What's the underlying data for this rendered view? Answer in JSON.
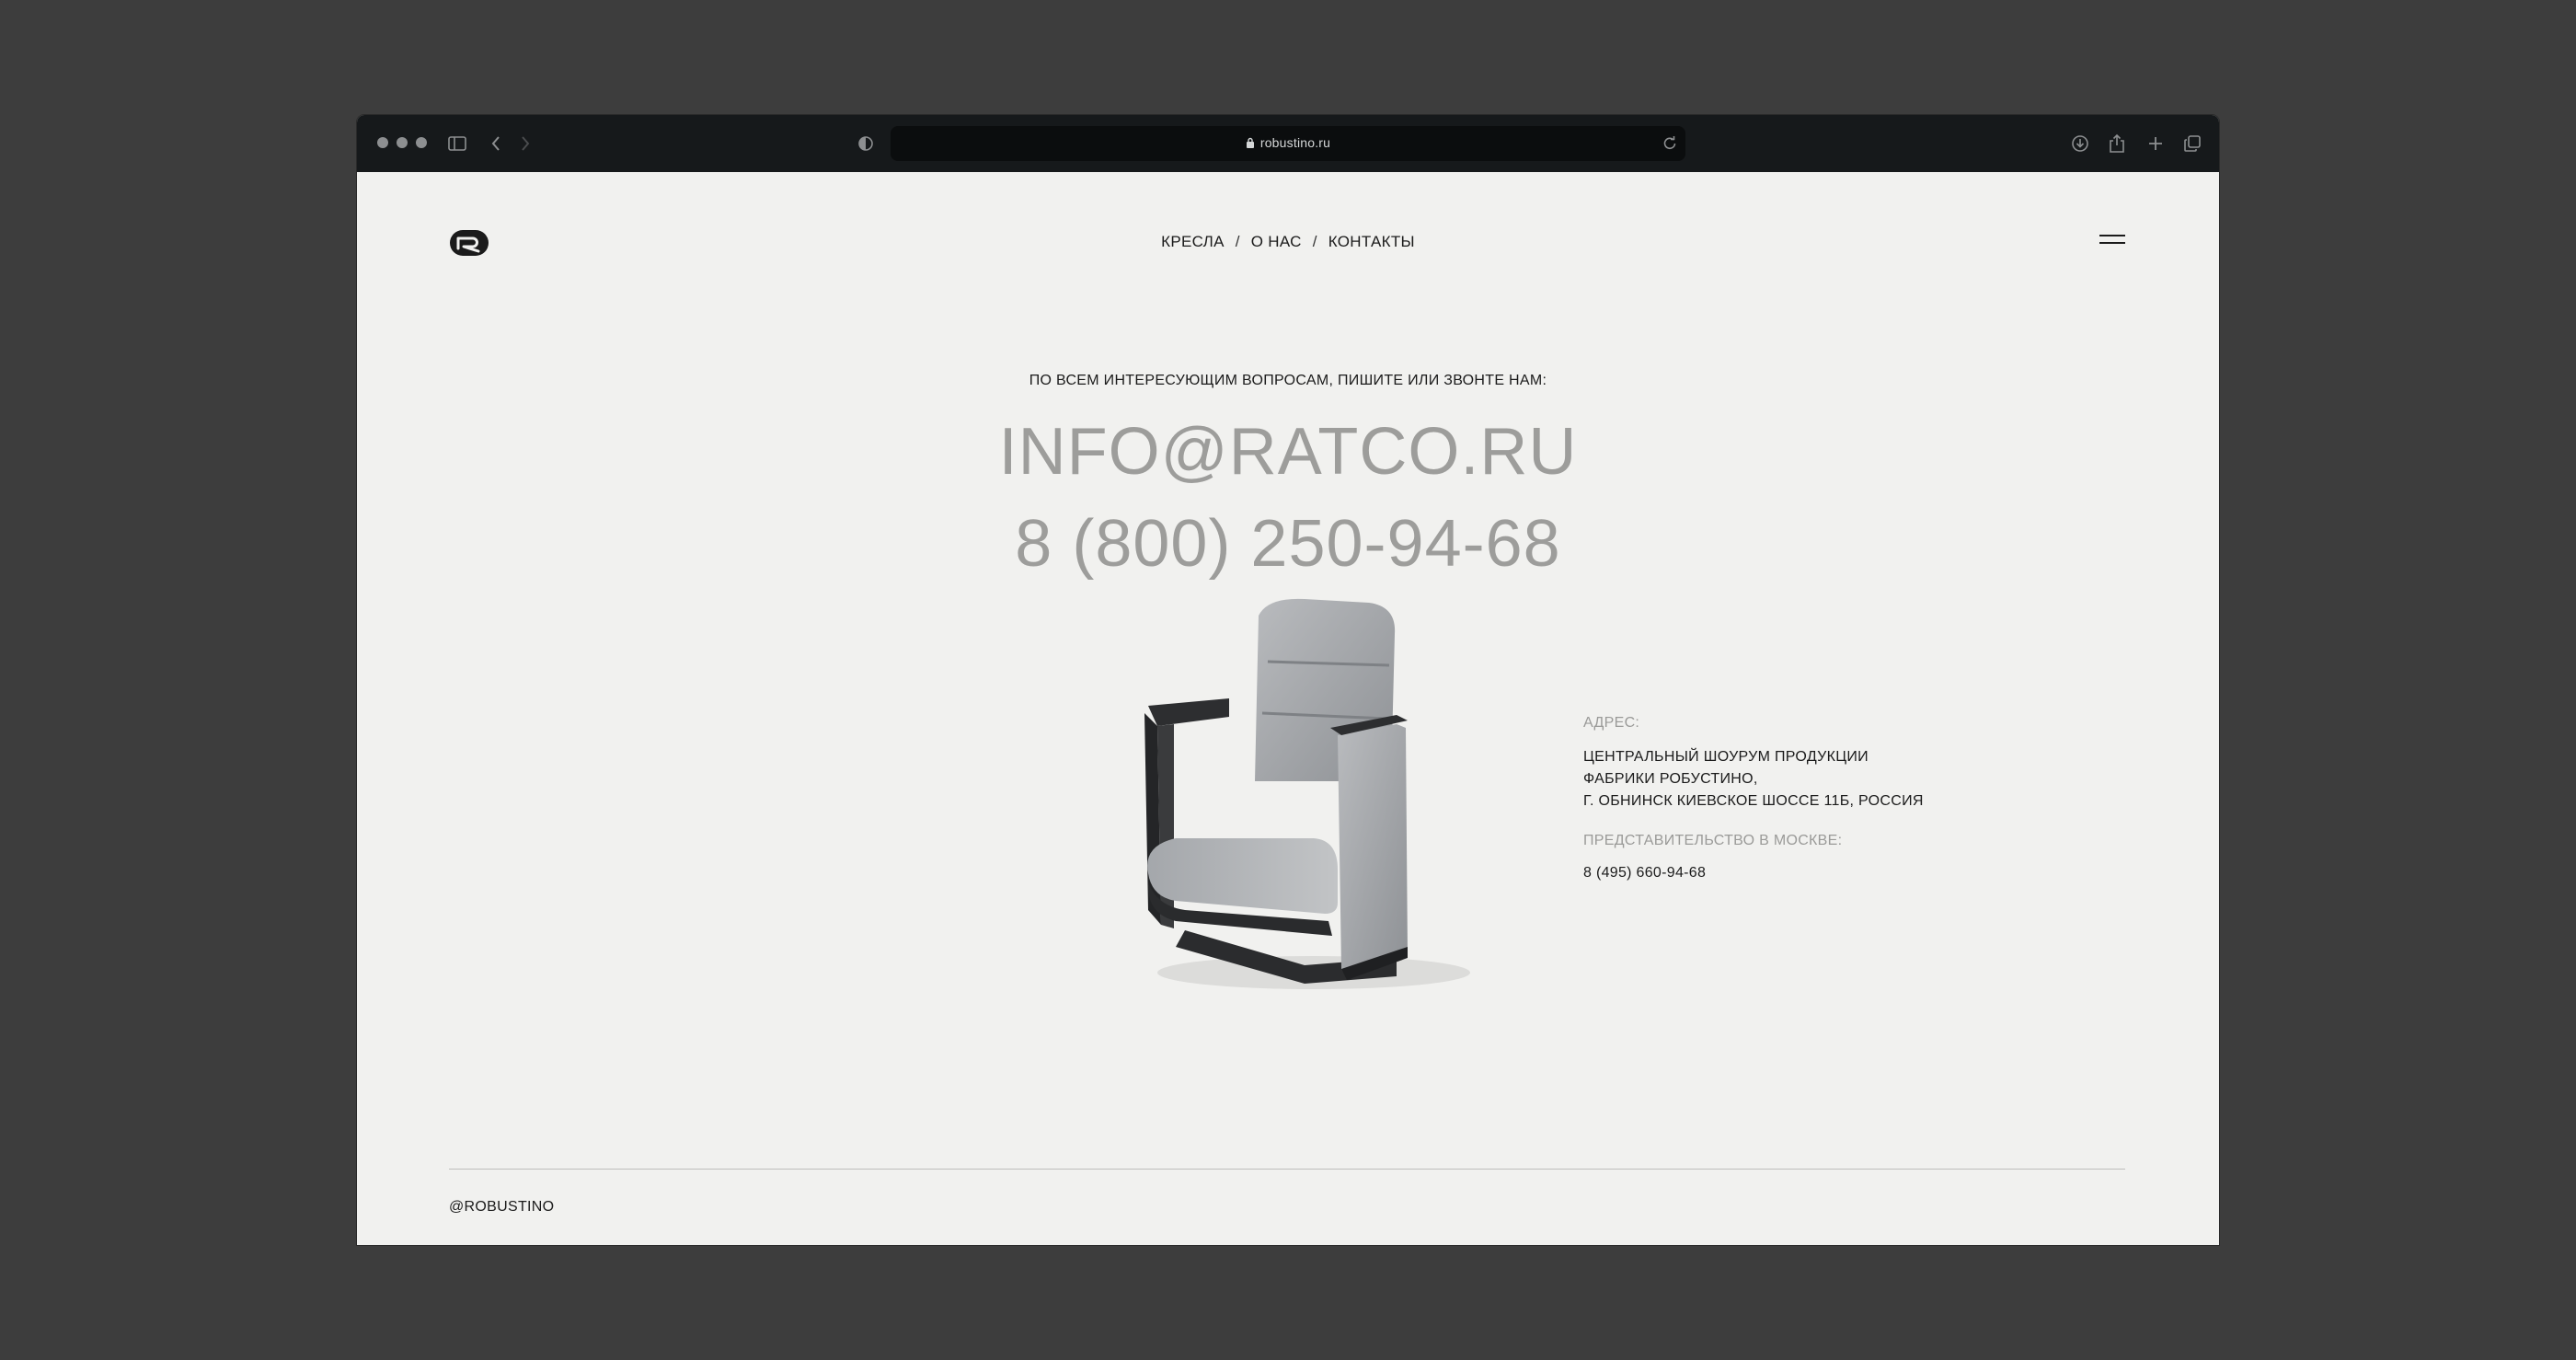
{
  "browser": {
    "url": "robustino.ru"
  },
  "nav": {
    "items": [
      "КРЕСЛА",
      "О НАС",
      "КОНТАКТЫ"
    ],
    "separator": "/"
  },
  "contacts": {
    "intro": "ПО ВСЕМ ИНТЕРЕСУЮЩИМ ВОПРОСАМ, ПИШИТЕ ИЛИ ЗВОНТЕ НАМ:",
    "email": "INFO@RATCO.RU",
    "phone": "8 (800) 250-94-68"
  },
  "address": {
    "label": "АДРЕС:",
    "lines": [
      "ЦЕНТРАЛЬНЫЙ ШОУРУМ ПРОДУКЦИИ",
      "ФАБРИКИ РОБУСТИНО,",
      "Г. ОБНИНСК КИЕВСКОЕ ШОССЕ 11Б, РОССИЯ"
    ],
    "moscow_label": "ПРЕДСТАВИТЕЛЬСТВО В МОСКВЕ:",
    "moscow_phone": "8 (495) 660-94-68"
  },
  "footer": {
    "handle": "@ROBUSTINO"
  },
  "colors": {
    "page_bg": "#f1f1ef",
    "toolbar_bg": "#16191b",
    "accent_grey": "#9d9d9b"
  }
}
